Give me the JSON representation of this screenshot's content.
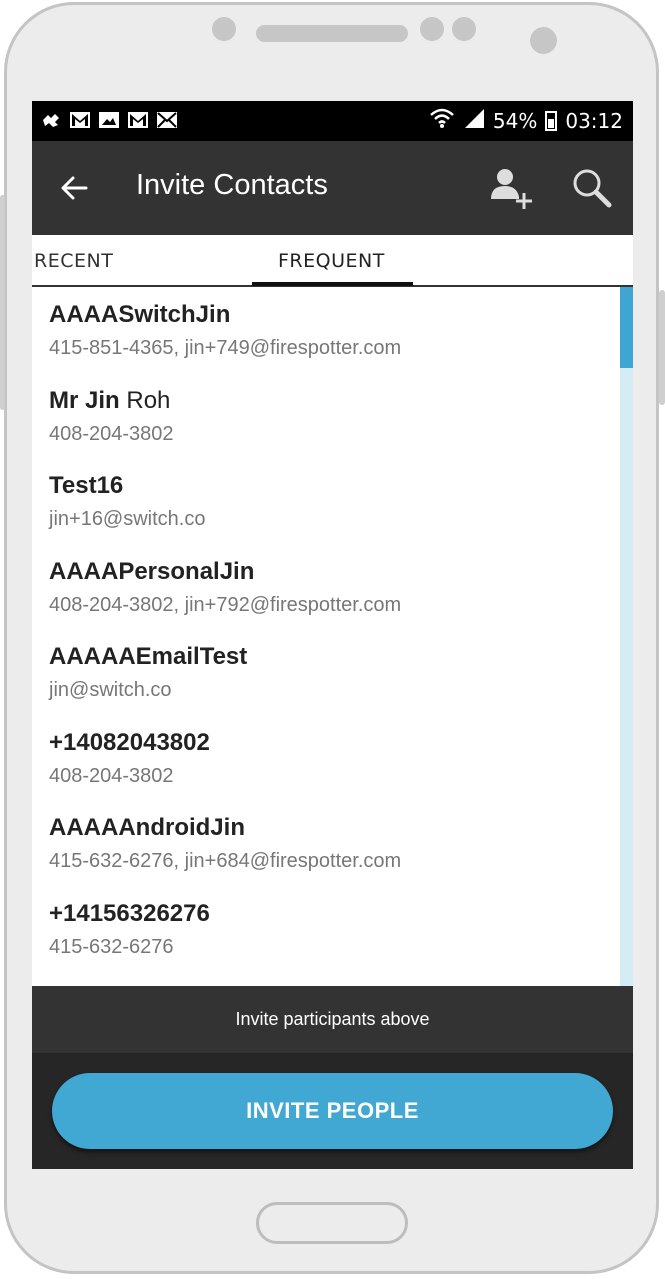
{
  "status_bar": {
    "battery": "54%",
    "time": "03:12",
    "notification_icons": [
      "puzzle-icon",
      "gmail-icon",
      "image-icon",
      "gmail-icon",
      "mail-icon"
    ]
  },
  "appbar": {
    "title": "Invite Contacts",
    "back_icon": "back-arrow-icon",
    "add_icon": "add-person-icon",
    "search_icon": "search-icon"
  },
  "tabs": [
    {
      "label": "RECENT",
      "selected": false
    },
    {
      "label": "FREQUENT",
      "selected": true
    }
  ],
  "contacts": [
    {
      "name": "AAAASwitchJin",
      "last": "",
      "detail": "415-851-4365, jin+749@firespotter.com"
    },
    {
      "name": "Mr Jin",
      "last": "Roh",
      "detail": "408-204-3802"
    },
    {
      "name": "Test16",
      "last": "",
      "detail": "jin+16@switch.co"
    },
    {
      "name": "AAAAPersonalJin",
      "last": "",
      "detail": "408-204-3802, jin+792@firespotter.com"
    },
    {
      "name": "AAAAAEmailTest",
      "last": "",
      "detail": "jin@switch.co"
    },
    {
      "name": "+14082043802",
      "last": "",
      "detail": "408-204-3802"
    },
    {
      "name": "AAAAAndroidJin",
      "last": "",
      "detail": "415-632-6276, jin+684@firespotter.com"
    },
    {
      "name": "+14156326276",
      "last": "",
      "detail": "415-632-6276"
    }
  ],
  "hint": "Invite participants above",
  "invite_button": "INVITE PEOPLE",
  "colors": {
    "accent": "#41a8d3",
    "appbar": "#333333",
    "scroll_track": "#d6ecf5"
  }
}
